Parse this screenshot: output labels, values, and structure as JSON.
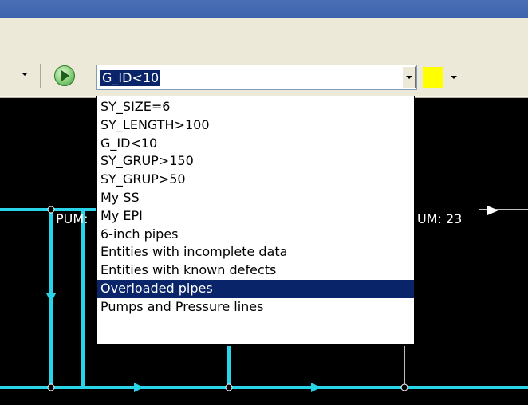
{
  "toolbar": {
    "query_value": "G_ID<10",
    "highlight_color": "#ffff00"
  },
  "dropdown": {
    "items": [
      "SY_SIZE=6",
      "SY_LENGTH>100",
      "G_ID<10",
      "SY_GRUP>150",
      "SY_GRUP>50",
      "My SS",
      "My EPI",
      "6-inch pipes",
      "Entities with incomplete data",
      "Entities with known defects",
      "Overloaded pipes",
      "Pumps and Pressure lines"
    ],
    "selected": "Overloaded pipes"
  },
  "canvas": {
    "labels": {
      "left": "PUM:",
      "right": "UM: 23"
    },
    "pipe_color": "#2ad4e8"
  }
}
